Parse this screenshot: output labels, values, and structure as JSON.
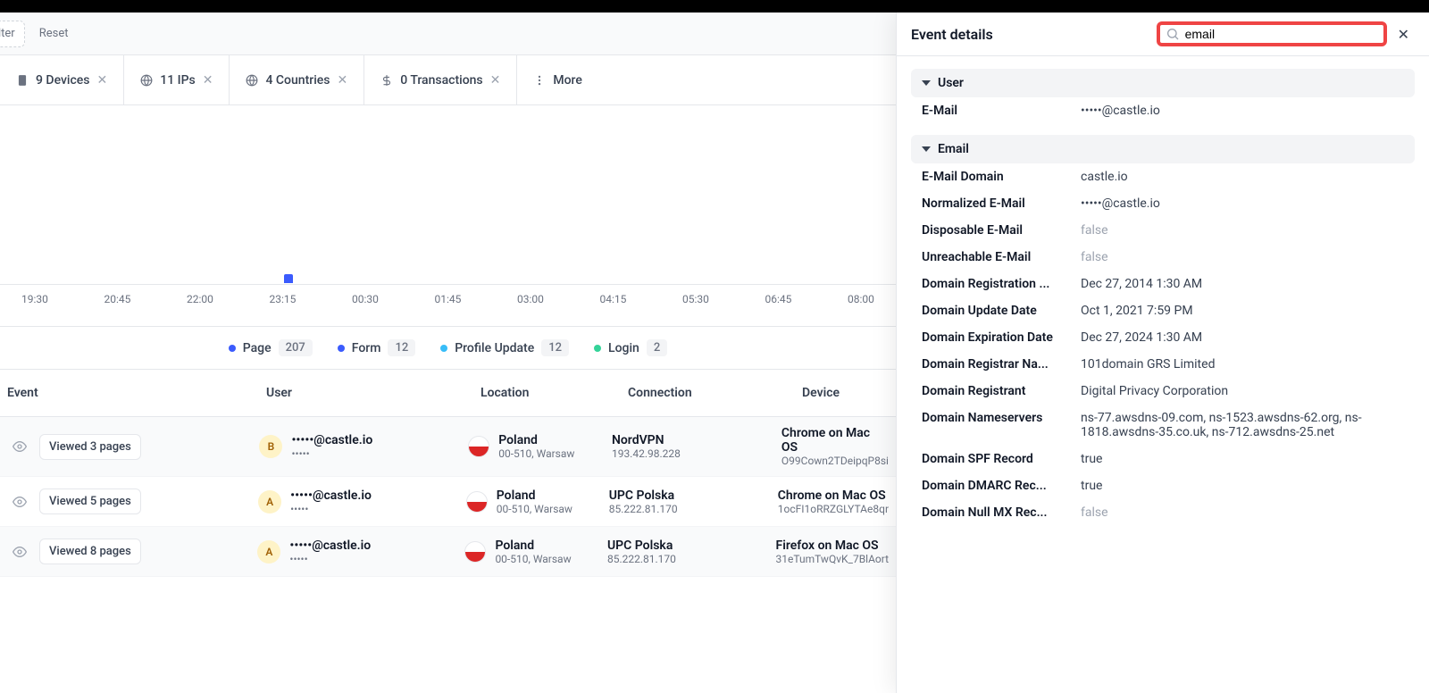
{
  "filter_row": {
    "filter_label": "lter",
    "reset_label": "Reset"
  },
  "tabs": [
    {
      "label": "9 Devices",
      "icon": "device"
    },
    {
      "label": "11 IPs",
      "icon": "globe"
    },
    {
      "label": "4 Countries",
      "icon": "globe"
    },
    {
      "label": "0 Transactions",
      "icon": "dollar"
    }
  ],
  "more_label": "More",
  "chart_data": {
    "type": "bar",
    "x_ticks": [
      "19:30",
      "20:45",
      "22:00",
      "23:15",
      "00:30",
      "01:45",
      "03:00",
      "04:15",
      "05:30",
      "06:45",
      "08:00"
    ],
    "bars": [
      {
        "tick_index": 3,
        "value": 10
      }
    ],
    "legend": [
      {
        "dot": "#3b5bfd",
        "label": "Page",
        "count": "207"
      },
      {
        "dot": "#3b5bfd",
        "label": "Form",
        "count": "12"
      },
      {
        "dot": "#38bdf8",
        "label": "Profile Update",
        "count": "12"
      },
      {
        "dot": "#34d399",
        "label": "Login",
        "count": "2"
      }
    ]
  },
  "table": {
    "headers": {
      "event": "Event",
      "user": "User",
      "location": "Location",
      "connection": "Connection",
      "device": "Device"
    },
    "rows": [
      {
        "event_badge": "Viewed 3 pages",
        "avatar": "B",
        "avatar_class": "b",
        "user_email": "•••••@castle.io",
        "user_sub": "•••••",
        "country": "Poland",
        "city": "00-510, Warsaw",
        "isp": "NordVPN",
        "ip": "193.42.98.228",
        "device": "Chrome on Mac OS",
        "device_id": "O99Cown2TDeipqP8si"
      },
      {
        "event_badge": "Viewed 5 pages",
        "avatar": "A",
        "avatar_class": "a",
        "user_email": "•••••@castle.io",
        "user_sub": "•••••",
        "country": "Poland",
        "city": "00-510, Warsaw",
        "isp": "UPC Polska",
        "ip": "85.222.81.170",
        "device": "Chrome on Mac OS",
        "device_id": "1ocFI1oRRZGLYTAe8qr"
      },
      {
        "event_badge": "Viewed 8 pages",
        "avatar": "A",
        "avatar_class": "a",
        "user_email": "•••••@castle.io",
        "user_sub": "•••••",
        "country": "Poland",
        "city": "00-510, Warsaw",
        "isp": "UPC Polska",
        "ip": "85.222.81.170",
        "device": "Firefox on Mac OS",
        "device_id": "31eTumTwQvK_7BlAort"
      }
    ]
  },
  "panel": {
    "title": "Event details",
    "search_value": "email",
    "sections": [
      {
        "name": "User",
        "rows": [
          {
            "k": "E-Mail",
            "v": "•••••@castle.io"
          }
        ]
      },
      {
        "name": "Email",
        "rows": [
          {
            "k": "E-Mail Domain",
            "v": "castle.io"
          },
          {
            "k": "Normalized E-Mail",
            "v": "•••••@castle.io"
          },
          {
            "k": "Disposable E-Mail",
            "v": "false",
            "muted": true
          },
          {
            "k": "Unreachable E-Mail",
            "v": "false",
            "muted": true
          },
          {
            "k": "Domain Registration ...",
            "v": "Dec 27, 2014 1:30 AM"
          },
          {
            "k": "Domain Update Date",
            "v": "Oct 1, 2021 7:59 PM"
          },
          {
            "k": "Domain Expiration Date",
            "v": "Dec 27, 2024 1:30 AM"
          },
          {
            "k": "Domain Registrar Na...",
            "v": "101domain GRS Limited"
          },
          {
            "k": "Domain Registrant",
            "v": "Digital Privacy Corporation"
          },
          {
            "k": "Domain Nameservers",
            "v": "ns-77.awsdns-09.com, ns-1523.awsdns-62.org, ns-1818.awsdns-35.co.uk, ns-712.awsdns-25.net"
          },
          {
            "k": "Domain SPF Record",
            "v": "true"
          },
          {
            "k": "Domain DMARC Rec...",
            "v": "true"
          },
          {
            "k": "Domain Null MX Rec...",
            "v": "false",
            "muted": true
          }
        ]
      }
    ]
  }
}
